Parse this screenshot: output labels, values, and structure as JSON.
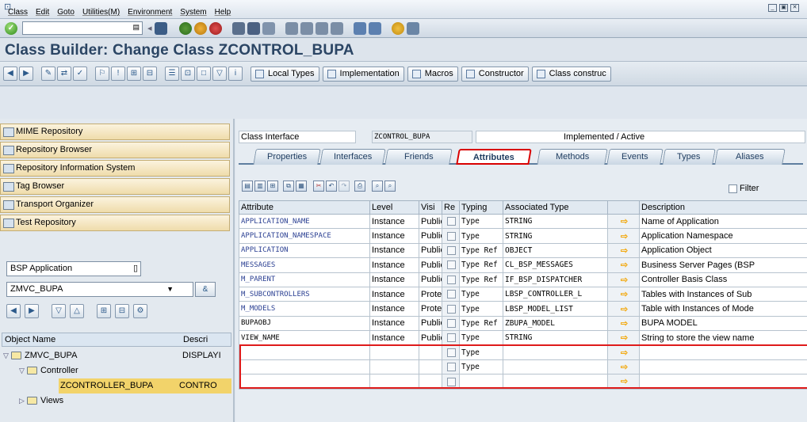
{
  "menubar": {
    "items": [
      "Class",
      "Edit",
      "Goto",
      "Utilities(M)",
      "Environment",
      "System",
      "Help"
    ]
  },
  "systoolbar": {
    "command_value": ""
  },
  "title": "Class Builder: Change Class ZCONTROL_BUPA",
  "apptoolbar": {
    "buttons": [
      "Local Types",
      "Implementation",
      "Macros",
      "Constructor",
      "Class construc"
    ]
  },
  "nav": {
    "items": [
      "MIME Repository",
      "Repository Browser",
      "Repository Information System",
      "Tag Browser",
      "Transport Organizer",
      "Test Repository"
    ],
    "object_type": "BSP Application",
    "object_name": "ZMVC_BUPA",
    "tree_columns": [
      "Object Name",
      "Descri"
    ],
    "tree": [
      {
        "name": "ZMVC_BUPA",
        "desc": "DISPLAYI"
      },
      {
        "name": "Controller",
        "desc": ""
      },
      {
        "name": "ZCONTROLLER_BUPA",
        "desc": "CONTRO"
      },
      {
        "name": "Views",
        "desc": ""
      }
    ]
  },
  "interface": {
    "label": "Class Interface",
    "value": "ZCONTROL_BUPA",
    "status": "Implemented / Active"
  },
  "tabs": [
    "Properties",
    "Interfaces",
    "Friends",
    "Attributes",
    "Methods",
    "Events",
    "Types",
    "Aliases"
  ],
  "active_tab": "Attributes",
  "filter_label": "Filter",
  "table": {
    "columns": [
      "Attribute",
      "Level",
      "Visi",
      "Re",
      "Typing",
      "Associated Type",
      "",
      "Description"
    ],
    "rows": [
      {
        "attr": "APPLICATION_NAME",
        "level": "Instance",
        "visi": "Public",
        "typing": "Type",
        "assoc": "STRING",
        "desc": "Name of Application"
      },
      {
        "attr": "APPLICATION_NAMESPACE",
        "level": "Instance",
        "visi": "Public",
        "typing": "Type",
        "assoc": "STRING",
        "desc": "Application Namespace"
      },
      {
        "attr": "APPLICATION",
        "level": "Instance",
        "visi": "Public",
        "typing": "Type Ref",
        "assoc": "OBJECT",
        "desc": "Application Object"
      },
      {
        "attr": "MESSAGES",
        "level": "Instance",
        "visi": "Public",
        "typing": "Type Ref",
        "assoc": "CL_BSP_MESSAGES",
        "desc": "Business Server Pages (BSP"
      },
      {
        "attr": "M_PARENT",
        "level": "Instance",
        "visi": "Public",
        "typing": "Type Ref",
        "assoc": "IF_BSP_DISPATCHER",
        "desc": "Controller Basis Class"
      },
      {
        "attr": "M_SUBCONTROLLERS",
        "level": "Instance",
        "visi": "Protec",
        "typing": "Type",
        "assoc": "LBSP_CONTROLLER_L",
        "desc": "Tables with Instances of Sub"
      },
      {
        "attr": "M_MODELS",
        "level": "Instance",
        "visi": "Protec",
        "typing": "Type",
        "assoc": "LBSP_MODEL_LIST",
        "desc": "Table with Instances of Mode"
      },
      {
        "attr": "BUPAOBJ",
        "level": "Instance",
        "visi": "Public",
        "typing": "Type Ref",
        "assoc": "ZBUPA_MODEL",
        "desc": "BUPA MODEL"
      },
      {
        "attr": "VIEW_NAME",
        "level": "Instance",
        "visi": "Public",
        "typing": "Type",
        "assoc": "STRING",
        "desc": "String to store the view name"
      },
      {
        "attr": "",
        "level": "",
        "visi": "",
        "typing": "Type",
        "assoc": "",
        "desc": ""
      },
      {
        "attr": "",
        "level": "",
        "visi": "",
        "typing": "Type",
        "assoc": "",
        "desc": ""
      },
      {
        "attr": "",
        "level": "",
        "visi": "",
        "typing": "",
        "assoc": "",
        "desc": ""
      }
    ]
  },
  "colors": {
    "highlight": "#df1b1b",
    "title_text": "#2b4564",
    "attr_text": "#2a3f92"
  }
}
